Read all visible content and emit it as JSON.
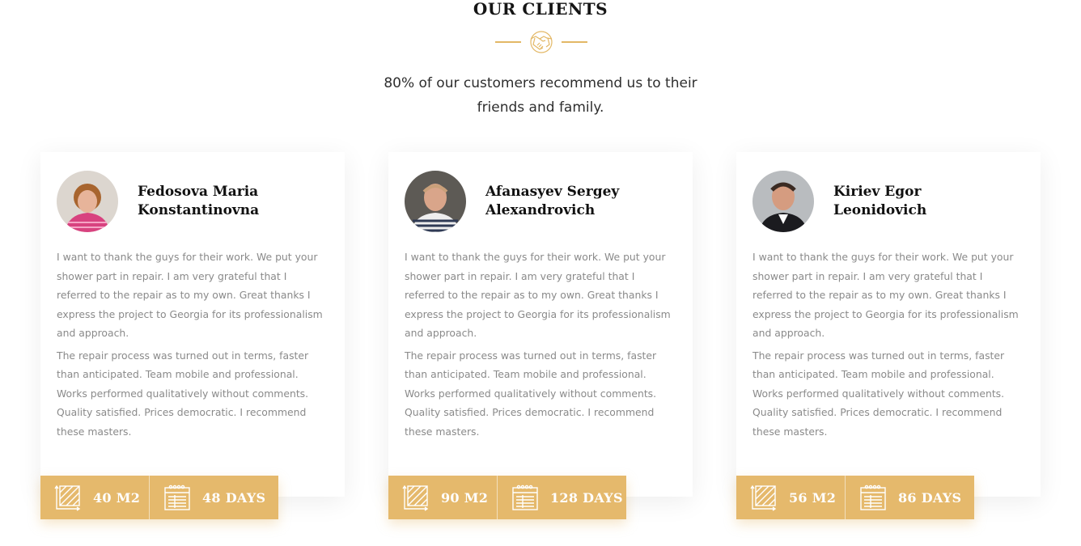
{
  "section": {
    "title": "OUR CLIENTS",
    "subtitle": "80% of our customers recommend us to their friends and family."
  },
  "colors": {
    "accent": "#e5b96c",
    "text_muted": "#8a8a8a",
    "heading": "#111111"
  },
  "icons": {
    "divider": "handshake-icon",
    "area": "area-icon",
    "days": "calendar-icon"
  },
  "clients": [
    {
      "name_line1": "Fedosova Maria",
      "name_line2": "Konstantinovna",
      "review_p1": "I want to thank the guys for their work. We put your shower part in repair. I am very grateful that I referred to the repair as to my own. Great thanks I express the project  to Georgia for its professionalism and approach.",
      "review_p2": "The repair process was turned out in terms, faster than anticipated. Team mobile and professional. Works performed qualitatively without comments. Quality satisfied. Prices democratic. I recommend these masters.",
      "area": "40 M2",
      "days": "48 DAYS"
    },
    {
      "name_line1": "Afanasyev Sergey",
      "name_line2": "Alexandrovich",
      "review_p1": "I want to thank the guys for their work. We put your shower part in repair. I am very grateful that I referred to the repair as to my own. Great thanks I express the project  to Georgia for its professionalism and approach.",
      "review_p2": "The repair process was turned out in terms, faster than anticipated. Team mobile and professional. Works performed qualitatively without comments. Quality satisfied. Prices democratic. I recommend these masters.",
      "area": "90 M2",
      "days": "128 DAYS"
    },
    {
      "name_line1": "Kiriev Egor",
      "name_line2": "Leonidovich",
      "review_p1": "I want to thank the guys for their work. We put your shower part in repair. I am very grateful that I referred to the repair as to my own. Great thanks I express the project  to Georgia for its professionalism and approach.",
      "review_p2": "The repair process was turned out in terms, faster than anticipated. Team mobile and professional. Works performed qualitatively without comments. Quality satisfied. Prices democratic. I recommend these masters.",
      "area": "56 M2",
      "days": "86 DAYS"
    }
  ]
}
